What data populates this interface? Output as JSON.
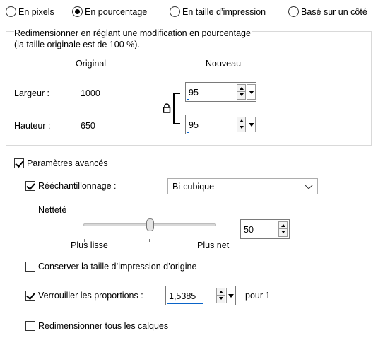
{
  "mode_options": [
    {
      "label": "En pixels",
      "selected": false
    },
    {
      "label": "En pourcentage",
      "selected": true
    },
    {
      "label": "En taille d’impression",
      "selected": false
    },
    {
      "label": "Basé sur un côté",
      "selected": false
    }
  ],
  "group": {
    "description_line1": "Redimensionner en réglant une modification en pourcentage",
    "description_line2": "(la taille originale est de 100 %).",
    "col_original": "Original",
    "col_new": "Nouveau",
    "width_label": "Largeur :",
    "width_original": "1000",
    "width_new": "95",
    "height_label": "Hauteur :",
    "height_original": "650",
    "height_new": "95",
    "link_icon": "lock-icon"
  },
  "advanced": {
    "label": "Paramètres avancés",
    "checked": true,
    "resample_label": "Rééchantillonnage :",
    "resample_checked": true,
    "resample_value": "Bi-cubique",
    "sharpness_label": "Netteté",
    "sharpness_left": "Plus lisse",
    "sharpness_right": "Plus net",
    "sharpness_value": "50",
    "sharpness_level_pct": 50,
    "keep_print_size_label": "Conserver la taille d’impression d’origine",
    "keep_print_size_checked": false,
    "lock_ratio_label": "Verrouiller les proportions :",
    "lock_ratio_checked": true,
    "ratio_value": "1,5385",
    "ratio_suffix": "pour 1",
    "resize_all_layers_label": "Redimensionner tous les calques",
    "resize_all_layers_checked": false
  },
  "colors": {
    "accent": "#0a64c8",
    "border": "#7a7a7a",
    "group_border": "#d9d9d9"
  }
}
